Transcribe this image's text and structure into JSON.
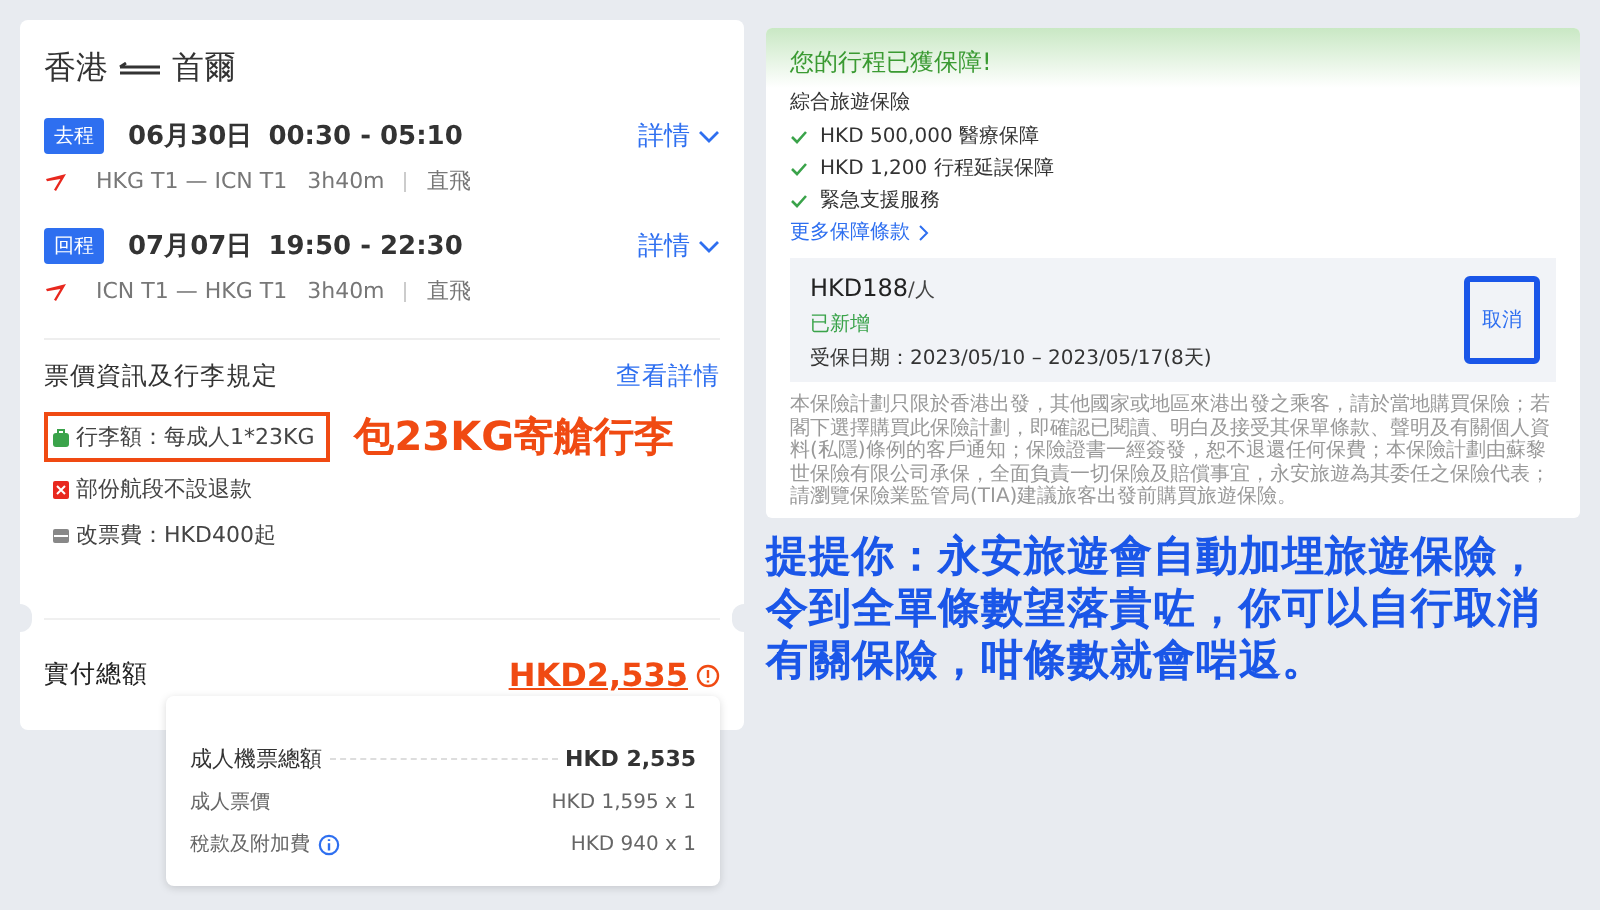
{
  "itinerary": {
    "title_from": "香港",
    "title_to": "首爾",
    "flights": [
      {
        "badge": "去程",
        "date": "06月30日",
        "time": "00:30 - 05:10",
        "details_link": "詳情",
        "route": "HKG T1 — ICN T1",
        "duration": "3h40m",
        "type": "直飛"
      },
      {
        "badge": "回程",
        "date": "07月07日",
        "time": "19:50 - 22:30",
        "details_link": "詳情",
        "route": "ICN T1 — HKG T1",
        "duration": "3h40m",
        "type": "直飛"
      }
    ],
    "rules_title": "票價資訊及行李規定",
    "rules_link": "查看詳情",
    "rules": [
      {
        "kind": "baggage",
        "text": "行李額：每成人1*23KG",
        "highlighted": true
      },
      {
        "kind": "refund",
        "text": "部份航段不設退款",
        "highlighted": false
      },
      {
        "kind": "change",
        "text": "改票費：HKD400起",
        "highlighted": false
      }
    ],
    "annotation": "包23KG寄艙行李",
    "total_label": "實付總額",
    "total_value": "HKD2,535"
  },
  "breakdown": {
    "rows": [
      {
        "kind": "total",
        "label": "成人機票總額",
        "value": "HKD 2,535"
      },
      {
        "kind": "item",
        "label": "成人票價",
        "value": "HKD 1,595 x 1",
        "info": false
      },
      {
        "kind": "item",
        "label": "稅款及附加費",
        "value": "HKD 940 x 1",
        "info": true
      }
    ]
  },
  "insurance": {
    "header": "您的行程已獲保障!",
    "plan": "綜合旅遊保險",
    "benefits": [
      "HKD 500,000 醫療保障",
      "HKD 1,200 行程延誤保障",
      "緊急支援服務"
    ],
    "more_link": "更多保障條款",
    "price": "HKD188",
    "per": "/人",
    "status": "已新增",
    "period": "受保日期：2023/05/10 – 2023/05/17(8天)",
    "cancel_button": {
      "label": "取消",
      "highlighted": true
    },
    "fine_print": "本保險計劃只限於香港出發，其他國家或地區來港出發之乘客，請於當地購買保險；若閣下選擇購買此保險計劃，即確認已閱讀、明白及接受其保單條款、聲明及有關個人資料(私隱)條例的客戶通知；保險證書一經簽發，恕不退還任何保費；本保險計劃由蘇黎世保險有限公司承保，全面負責一切保險及賠償事宜，永安旅遊為其委任之保險代表；請瀏覽保險業監管局(TIA)建議旅客出發前購買旅遊保險。"
  },
  "tip": "提提你：永安旅遊會自動加埋旅遊保險，令到全單條數望落貴咗，你可以自行取消有關保險，咁條數就會啱返。"
}
